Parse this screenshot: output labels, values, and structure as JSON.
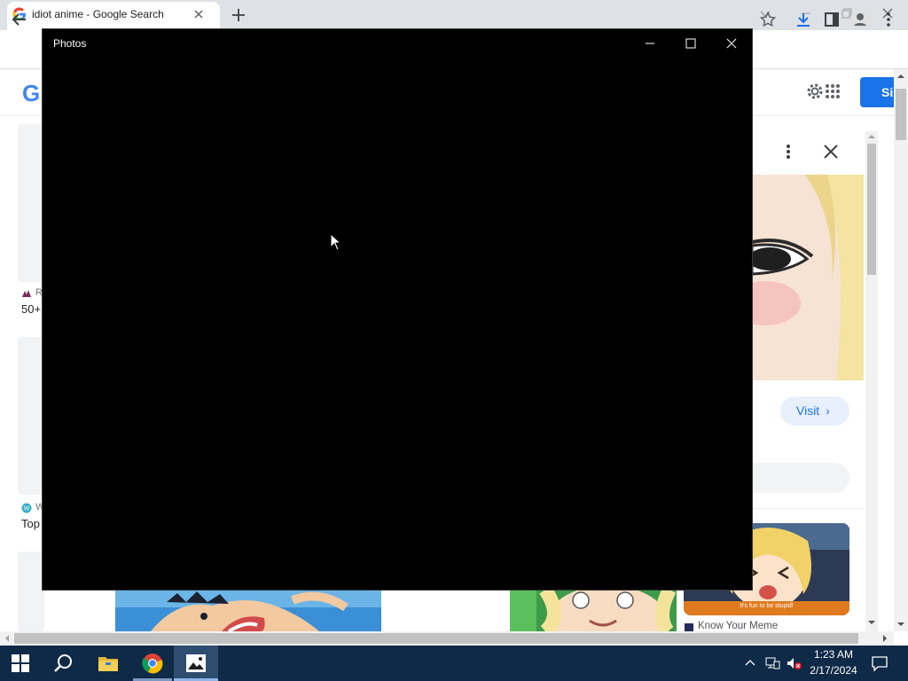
{
  "browser": {
    "tab": {
      "title": "idiot anime - Google Search"
    },
    "toolbar": {
      "back": "back-arrow-icon",
      "bookmark": "star-icon",
      "downloads": "download-icon",
      "side_panel": "side-panel-icon",
      "profile": "profile-icon",
      "menu": "kebab-menu-icon"
    },
    "colors": {
      "tab_strip": "#dee1e6",
      "accent": "#1a73e8"
    }
  },
  "page": {
    "logo_letter": "G",
    "signin_label": "Si",
    "results": [
      {
        "source": "R",
        "title": "50+"
      },
      {
        "source": "W",
        "title": "Top"
      }
    ],
    "side_panel": {
      "visit_label": "Visit",
      "visit_chevron": "›",
      "related_caption": "It's fun to be stupid!",
      "related_source": "Know Your Meme"
    }
  },
  "photos": {
    "title": "Photos",
    "background": "#000000"
  },
  "taskbar": {
    "time": "1:23 AM",
    "date": "2/17/2024",
    "apps": [
      "start",
      "search",
      "file-explorer",
      "chrome",
      "photos"
    ],
    "active_app": "photos",
    "color": "#0e2a47"
  }
}
